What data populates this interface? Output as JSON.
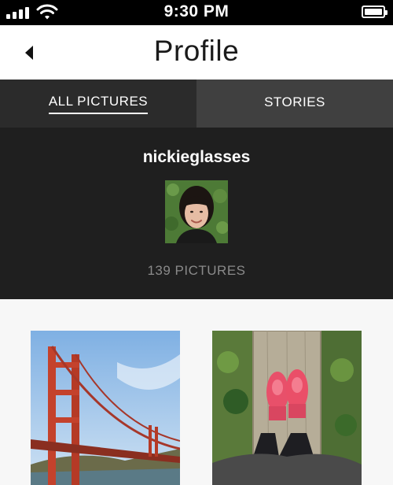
{
  "status_bar": {
    "time": "9:30 PM",
    "signal_icon": "cellular-signal-icon",
    "wifi_icon": "wifi-icon",
    "battery_icon": "battery-icon",
    "battery_level": 1.0
  },
  "header": {
    "back_icon": "back-arrow-icon",
    "title": "Profile"
  },
  "tabs": [
    {
      "label": "ALL PICTURES",
      "active": true
    },
    {
      "label": "STORIES",
      "active": false
    }
  ],
  "profile": {
    "username": "nickieglasses",
    "picture_count": "139 PICTURES"
  },
  "grid": {
    "photos": [
      {
        "subject": "golden-gate-bridge-photo"
      },
      {
        "subject": "pink-sneakers-photo"
      }
    ]
  },
  "colors": {
    "status_bar": "#000000",
    "header_bg": "#ffffff",
    "tab_active_bg": "#2b2b2b",
    "tab_inactive_bg": "#404040",
    "profile_bg": "#1f1f1f",
    "grid_bg": "#f7f7f7"
  }
}
